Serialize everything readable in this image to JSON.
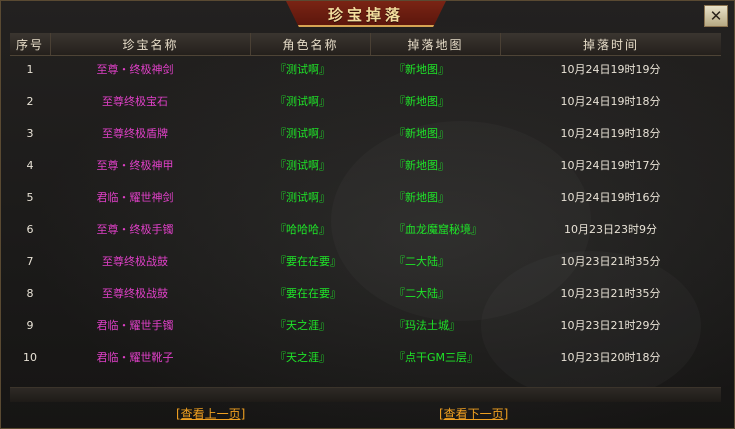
{
  "window": {
    "title": "珍宝掉落",
    "close_icon": "close-icon"
  },
  "table": {
    "headers": [
      "序号",
      "珍宝名称",
      "角色名称",
      "掉落地图",
      "掉落时间"
    ],
    "rows": [
      {
        "index": "1",
        "item": "至尊・终极神剑",
        "role": "『测试啊』",
        "map": "『新地图』",
        "time": "10月24日19时19分"
      },
      {
        "index": "2",
        "item": "至尊终极宝石",
        "role": "『测试啊』",
        "map": "『新地图』",
        "time": "10月24日19时18分"
      },
      {
        "index": "3",
        "item": "至尊终极盾牌",
        "role": "『测试啊』",
        "map": "『新地图』",
        "time": "10月24日19时18分"
      },
      {
        "index": "4",
        "item": "至尊・终极神甲",
        "role": "『测试啊』",
        "map": "『新地图』",
        "time": "10月24日19时17分"
      },
      {
        "index": "5",
        "item": "君临・耀世神剑",
        "role": "『测试啊』",
        "map": "『新地图』",
        "time": "10月24日19时16分"
      },
      {
        "index": "6",
        "item": "至尊・终极手镯",
        "role": "『哈哈哈』",
        "map": "『血龙魔窟秘境』",
        "time": "10月23日23时9分"
      },
      {
        "index": "7",
        "item": "至尊终极战鼓",
        "role": "『要在在要』",
        "map": "『二大陆』",
        "time": "10月23日21时35分"
      },
      {
        "index": "8",
        "item": "至尊终极战鼓",
        "role": "『要在在要』",
        "map": "『二大陆』",
        "time": "10月23日21时35分"
      },
      {
        "index": "9",
        "item": "君临・耀世手镯",
        "role": "『天之涯』",
        "map": "『玛法土城』",
        "time": "10月23日21时29分"
      },
      {
        "index": "10",
        "item": "君临・耀世靴子",
        "role": "『天之涯』",
        "map": "『点干GM三层』",
        "time": "10月23日20时18分"
      }
    ]
  },
  "pager": {
    "prev_label": "[查看上一页]",
    "next_label": "[查看下一页]"
  },
  "colors": {
    "item_name": "#e040c8",
    "role_name": "#1ee628",
    "map_name": "#1ee628",
    "pager_link": "#f0a020",
    "title_bg": "#7a2414"
  }
}
